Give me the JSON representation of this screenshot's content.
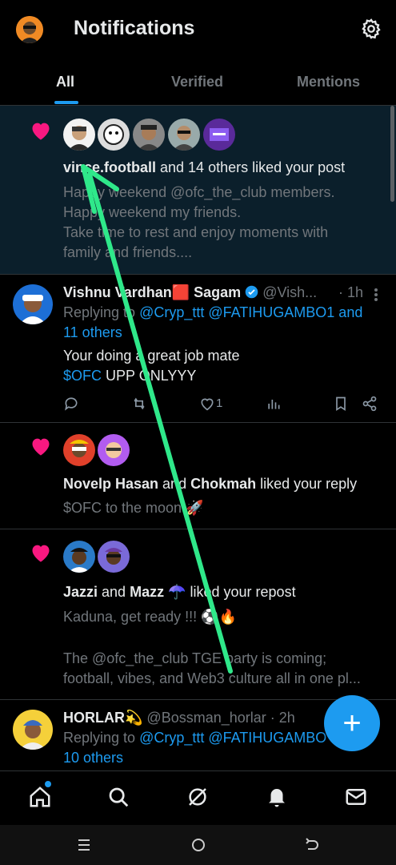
{
  "header": {
    "title": "Notifications"
  },
  "tabs": [
    {
      "label": "All"
    },
    {
      "label": "Verified"
    },
    {
      "label": "Mentions"
    }
  ],
  "notif1": {
    "user": "vince.football",
    "rest": " and 14 others liked your post",
    "lines": [
      "Happy weekend @ofc_the_club members.",
      "Happy weekend my friends.",
      "Take time to rest and enjoy moments with",
      "family and friends...."
    ]
  },
  "reply1": {
    "name": "Vishnu Vardhan",
    "flag": "🟥",
    "name2": " Sagam",
    "handle": "@Vish...",
    "time": "· 1h",
    "replying": "Replying to ",
    "mentions": "@Cryp_ttt @FATIHUGAMBO1 and",
    "mentions2": "11 others",
    "text1": "Your doing a great job mate",
    "cashtag": "$OFC",
    "text2": " UPP ONLYYY",
    "likes": "1"
  },
  "notif2": {
    "user1": "Novelp Hasan",
    "mid": " and ",
    "user2": "Chokmah",
    "rest": " liked your reply",
    "text": "$OFC to the moon 🚀"
  },
  "notif3": {
    "user1": "Jazzi",
    "mid": " and ",
    "user2": "Mazz ☂️",
    "rest": " liked your repost",
    "text1": "Kaduna, get ready !!! ⚽🔥",
    "text2": "The @ofc_the_club TGE party is coming;",
    "text3": "football, vibes, and Web3 culture all in one pl..."
  },
  "reply2": {
    "name": "HORLAR💫",
    "handle": "@Bossman_horlar",
    "time": "· 2h",
    "replying": "Replying to ",
    "mentions": "@Cryp_ttt @FATIHUGAMBO",
    "mentions2": "10 others"
  },
  "fab": {
    "label": "+"
  },
  "colors": {
    "accent": "#1d9bf0",
    "heart": "#f91880",
    "arrow": "#2fe88a"
  }
}
